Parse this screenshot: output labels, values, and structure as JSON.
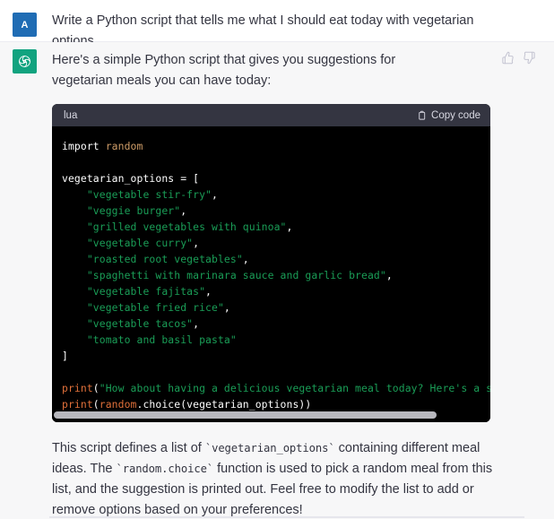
{
  "colors": {
    "user_avatar_bg": "#1f6cb4",
    "assistant_avatar_bg": "#11a37f",
    "assistant_turn_bg": "#f7f7f8",
    "code_header_bg": "#343541",
    "code_body_bg": "#000000",
    "string_green": "#1a9e57",
    "function_orange": "#e0703a",
    "module_tan": "#cf9d68",
    "text_color": "#343541"
  },
  "user_turn": {
    "avatar_initial": "A",
    "message": "Write a Python script that tells me what I should eat today with vegetarian options."
  },
  "assistant_turn": {
    "avatar_icon": "openai-logo-icon",
    "intro": "Here's a simple Python script that gives you suggestions for vegetarian meals you can have today:",
    "feedback": {
      "thumbs_up": "thumbs-up-icon",
      "thumbs_down": "thumbs-down-icon"
    },
    "code_block": {
      "language": "lua",
      "copy_label": "Copy code",
      "copy_icon": "clipboard-icon",
      "lines": [
        {
          "segments": [
            {
              "t": "import",
              "c": "tok-kw"
            },
            {
              "t": " "
            },
            {
              "t": "random",
              "c": "tok-mod"
            }
          ]
        },
        {
          "segments": [
            {
              "t": ""
            }
          ]
        },
        {
          "segments": [
            {
              "t": "vegetarian_options = [",
              "c": "tok-name"
            }
          ]
        },
        {
          "segments": [
            {
              "t": "    "
            },
            {
              "t": "\"vegetable stir-fry\"",
              "c": "tok-str"
            },
            {
              "t": ",",
              "c": "tok-punct"
            }
          ]
        },
        {
          "segments": [
            {
              "t": "    "
            },
            {
              "t": "\"veggie burger\"",
              "c": "tok-str"
            },
            {
              "t": ",",
              "c": "tok-punct"
            }
          ]
        },
        {
          "segments": [
            {
              "t": "    "
            },
            {
              "t": "\"grilled vegetables with quinoa\"",
              "c": "tok-str"
            },
            {
              "t": ",",
              "c": "tok-punct"
            }
          ]
        },
        {
          "segments": [
            {
              "t": "    "
            },
            {
              "t": "\"vegetable curry\"",
              "c": "tok-str"
            },
            {
              "t": ",",
              "c": "tok-punct"
            }
          ]
        },
        {
          "segments": [
            {
              "t": "    "
            },
            {
              "t": "\"roasted root vegetables\"",
              "c": "tok-str"
            },
            {
              "t": ",",
              "c": "tok-punct"
            }
          ]
        },
        {
          "segments": [
            {
              "t": "    "
            },
            {
              "t": "\"spaghetti with marinara sauce and garlic bread\"",
              "c": "tok-str"
            },
            {
              "t": ",",
              "c": "tok-punct"
            }
          ]
        },
        {
          "segments": [
            {
              "t": "    "
            },
            {
              "t": "\"vegetable fajitas\"",
              "c": "tok-str"
            },
            {
              "t": ",",
              "c": "tok-punct"
            }
          ]
        },
        {
          "segments": [
            {
              "t": "    "
            },
            {
              "t": "\"vegetable fried rice\"",
              "c": "tok-str"
            },
            {
              "t": ",",
              "c": "tok-punct"
            }
          ]
        },
        {
          "segments": [
            {
              "t": "    "
            },
            {
              "t": "\"vegetable tacos\"",
              "c": "tok-str"
            },
            {
              "t": ",",
              "c": "tok-punct"
            }
          ]
        },
        {
          "segments": [
            {
              "t": "    "
            },
            {
              "t": "\"tomato and basil pasta\"",
              "c": "tok-str"
            }
          ]
        },
        {
          "segments": [
            {
              "t": "]",
              "c": "tok-name"
            }
          ]
        },
        {
          "segments": [
            {
              "t": ""
            }
          ]
        },
        {
          "segments": [
            {
              "t": "print",
              "c": "tok-fn"
            },
            {
              "t": "(",
              "c": "tok-punct"
            },
            {
              "t": "\"How about having a delicious vegetarian meal today? Here's a suggestion for you:\"",
              "c": "tok-str"
            },
            {
              "t": ")",
              "c": "tok-punct"
            }
          ]
        },
        {
          "segments": [
            {
              "t": "print",
              "c": "tok-fn"
            },
            {
              "t": "(",
              "c": "tok-punct"
            },
            {
              "t": "random",
              "c": "tok-fn"
            },
            {
              "t": ".choice(vegetarian_options))",
              "c": "tok-name"
            }
          ]
        }
      ]
    },
    "explanation": {
      "part1": "This script defines a list of ",
      "code1": "`vegetarian_options`",
      "part2": " containing different meal ideas. The ",
      "code2": "`random.choice`",
      "part3": " function is used to pick a random meal from this list, and the suggestion is printed out. Feel free to modify the list to add or remove options based on your preferences!"
    }
  }
}
